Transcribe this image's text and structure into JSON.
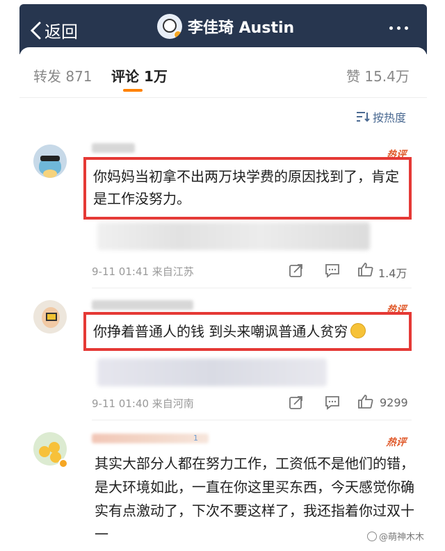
{
  "header": {
    "back_label": "返回",
    "title": "李佳琦 Austin"
  },
  "tabs": {
    "repost": "转发 871",
    "comments": "评论 1万",
    "likes": "赞 15.4万"
  },
  "sort": {
    "label": "按热度"
  },
  "comments": [
    {
      "badge": "热评",
      "text": "你妈妈当初拿不出两万块学费的原因找到了，肯定是工作没努力。",
      "meta": "9-11 01:41 来自江苏",
      "like_count": "1.4万"
    },
    {
      "badge": "热评",
      "text": "你挣着普通人的钱 到头来嘲讽普通人贫穷",
      "meta": "9-11 01:40 来自河南",
      "like_count": "9299"
    },
    {
      "badge": "热评",
      "level": "1",
      "text": "其实大部分人都在努力工作，工资低不是他们的错，是大环境如此，一直在你这里买东西，今天感觉你确实有点激动了，下次不要这样了，我还指着你过双十一"
    }
  ],
  "watermark": {
    "text": "@萌神木木"
  },
  "colors": {
    "header_bg": "#27364f",
    "tab_underline": "#ff8200",
    "hot_badge": "#e05a2b",
    "highlight_box": "#e53935",
    "link_blue": "#4b6a92"
  },
  "icons": {
    "back": "chevron-left-icon",
    "more": "more-dots-icon",
    "sort": "sort-icon",
    "repost": "share-icon",
    "reply": "comment-icon",
    "like": "thumbs-up-icon"
  }
}
